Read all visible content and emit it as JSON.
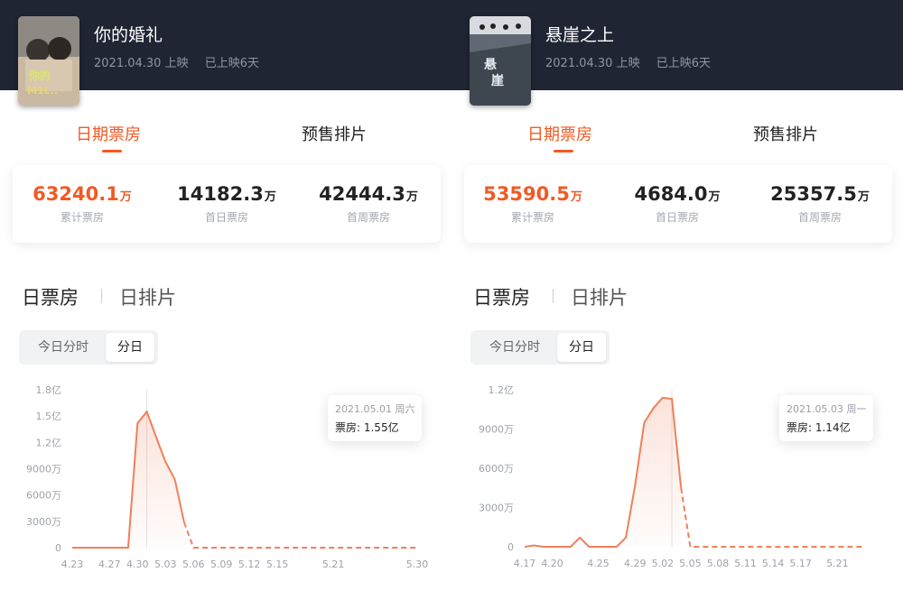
{
  "panels": [
    {
      "movie": {
        "title": "你的婚礼",
        "release": "2021.04.30 上映",
        "days": "已上映6天",
        "poster_icon": "movie-poster-couple"
      },
      "tabs": [
        "日期票房",
        "预售排片"
      ],
      "stats": [
        {
          "value": "63240.1",
          "unit": "万",
          "label": "累计票房"
        },
        {
          "value": "14182.3",
          "unit": "万",
          "label": "首日票房"
        },
        {
          "value": "42444.3",
          "unit": "万",
          "label": "首周票房"
        }
      ],
      "section_tabs": [
        "日票房",
        "日排片"
      ],
      "segments": [
        "今日分时",
        "分日"
      ],
      "tooltip": {
        "date": "2021.05.01 周六",
        "value": "票房: 1.55亿"
      },
      "chart_data": {
        "type": "line",
        "x": [
          "4.23",
          "4.24",
          "4.25",
          "4.26",
          "4.27",
          "4.28",
          "4.29",
          "4.30",
          "5.01",
          "5.02",
          "5.03",
          "5.04",
          "5.05",
          "5.06",
          "5.07",
          "5.08",
          "5.09",
          "5.10",
          "5.11",
          "5.12",
          "5.13",
          "5.14",
          "5.15",
          "5.16",
          "5.17",
          "5.18",
          "5.19",
          "5.20",
          "5.21",
          "5.22",
          "5.23",
          "5.24",
          "5.25",
          "5.26",
          "5.27",
          "5.28",
          "5.29",
          "5.30"
        ],
        "x_tick_labels": [
          "4.23",
          "4.27",
          "4.30",
          "5.03",
          "5.06",
          "5.09",
          "5.12",
          "5.15",
          "5.21",
          "5.30"
        ],
        "y_tick_labels": [
          "0",
          "3000万",
          "6000万",
          "9000万",
          "1.2亿",
          "1.5亿",
          "1.8亿"
        ],
        "ylim": [
          0,
          18000
        ],
        "y_unit": "万",
        "series": [
          {
            "values": [
              0,
              0,
              0,
              0,
              0,
              0,
              0,
              14182.3,
              15500,
              12600,
              9800,
              7800,
              2900,
              0,
              0,
              0,
              0,
              0,
              0,
              0,
              0,
              0,
              0,
              0,
              0,
              0,
              0,
              0,
              0,
              0,
              0,
              0,
              0,
              0,
              0,
              0,
              0,
              0
            ]
          }
        ],
        "solid_until_index": 12,
        "highlight_index": 8,
        "color": "#f0805a"
      }
    },
    {
      "movie": {
        "title": "悬崖之上",
        "release": "2021.04.30 上映",
        "days": "已上映6天",
        "poster_icon": "movie-poster-snow"
      },
      "tabs": [
        "日期票房",
        "预售排片"
      ],
      "stats": [
        {
          "value": "53590.5",
          "unit": "万",
          "label": "累计票房"
        },
        {
          "value": "4684.0",
          "unit": "万",
          "label": "首日票房"
        },
        {
          "value": "25357.5",
          "unit": "万",
          "label": "首周票房"
        }
      ],
      "section_tabs": [
        "日票房",
        "日排片"
      ],
      "segments": [
        "今日分时",
        "分日"
      ],
      "tooltip": {
        "date": "2021.05.03 周一",
        "value": "票房: 1.14亿"
      },
      "chart_data": {
        "type": "line",
        "x": [
          "4.17",
          "4.18",
          "4.19",
          "4.20",
          "4.21",
          "4.22",
          "4.23",
          "4.24",
          "4.25",
          "4.26",
          "4.27",
          "4.28",
          "4.29",
          "4.30",
          "5.01",
          "5.02",
          "5.03",
          "5.04",
          "5.05",
          "5.06",
          "5.07",
          "5.08",
          "5.09",
          "5.10",
          "5.11",
          "5.12",
          "5.13",
          "5.14",
          "5.15",
          "5.16",
          "5.17",
          "5.18",
          "5.19",
          "5.20",
          "5.21",
          "5.22",
          "5.23",
          "5.24"
        ],
        "x_tick_labels": [
          "4.17",
          "4.20",
          "4.25",
          "4.29",
          "5.02",
          "5.05",
          "5.08",
          "5.11",
          "5.14",
          "5.17",
          "5.21"
        ],
        "y_tick_labels": [
          "0",
          "3000万",
          "6000万",
          "9000万",
          "1.2亿"
        ],
        "ylim": [
          0,
          12000
        ],
        "y_unit": "万",
        "series": [
          {
            "values": [
              0,
              100,
              0,
              0,
              0,
              0,
              700,
              0,
              0,
              0,
              0,
              700,
              4684,
              9500,
              10600,
              11400,
              11300,
              4500,
              0,
              0,
              0,
              0,
              0,
              0,
              0,
              0,
              0,
              0,
              0,
              0,
              0,
              0,
              0,
              0,
              0,
              0,
              0,
              0
            ]
          }
        ],
        "solid_until_index": 17,
        "highlight_index": 16,
        "color": "#f0805a"
      }
    }
  ]
}
